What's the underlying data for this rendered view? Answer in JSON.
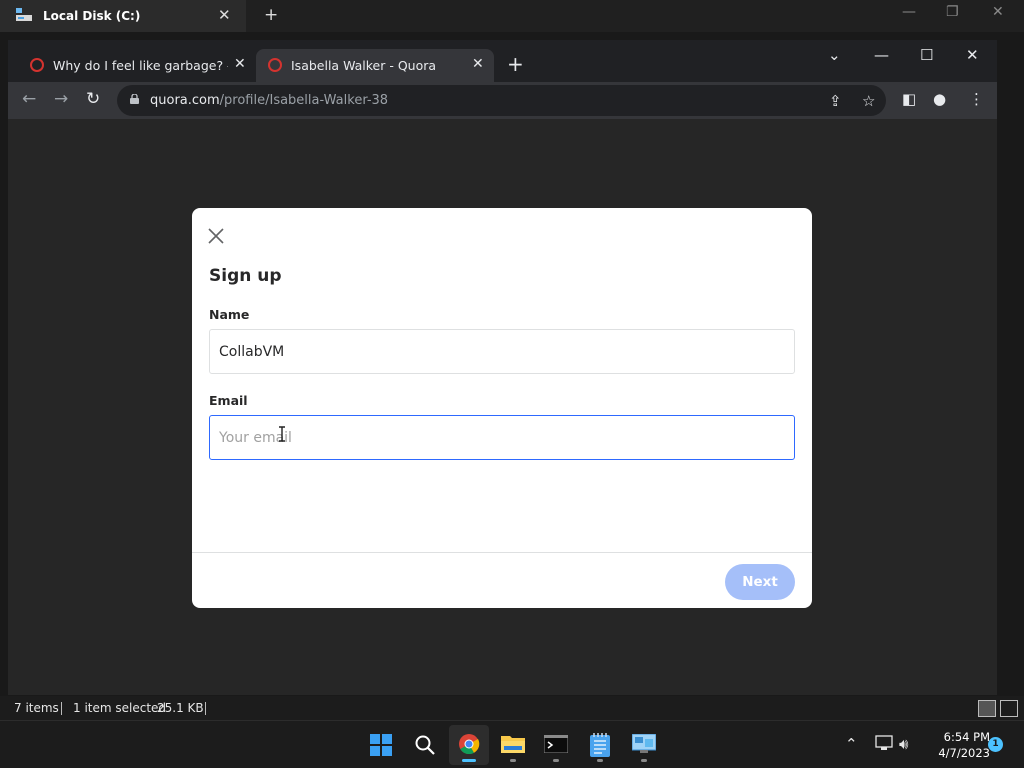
{
  "explorer": {
    "title": "Local Disk (C:)",
    "status": {
      "items": "7 items",
      "selected": "1 item selected",
      "size": "25.1 KB"
    }
  },
  "browser": {
    "tabs": [
      {
        "label": "Why do I feel like garbage? - Quora",
        "active": false
      },
      {
        "label": "Isabella Walker - Quora",
        "active": true
      }
    ],
    "url": {
      "host": "quora.com",
      "path": "/profile/Isabella-Walker-38"
    }
  },
  "modal": {
    "title": "Sign up",
    "name_label": "Name",
    "name_value": "CollabVM",
    "email_label": "Email",
    "email_placeholder": "Your email",
    "next_label": "Next"
  },
  "taskbar": {
    "apps": [
      "start-icon",
      "search-icon",
      "chrome-icon",
      "file-explorer-icon",
      "terminal-icon",
      "notepad-icon",
      "control-panel-icon"
    ],
    "time": "6:54 PM",
    "date": "4/7/2023",
    "notifications": "1"
  },
  "colors": {
    "accent": "#2e69ff",
    "next_button": "#a5bff9",
    "taskbar_active": "#4cc2ff"
  }
}
